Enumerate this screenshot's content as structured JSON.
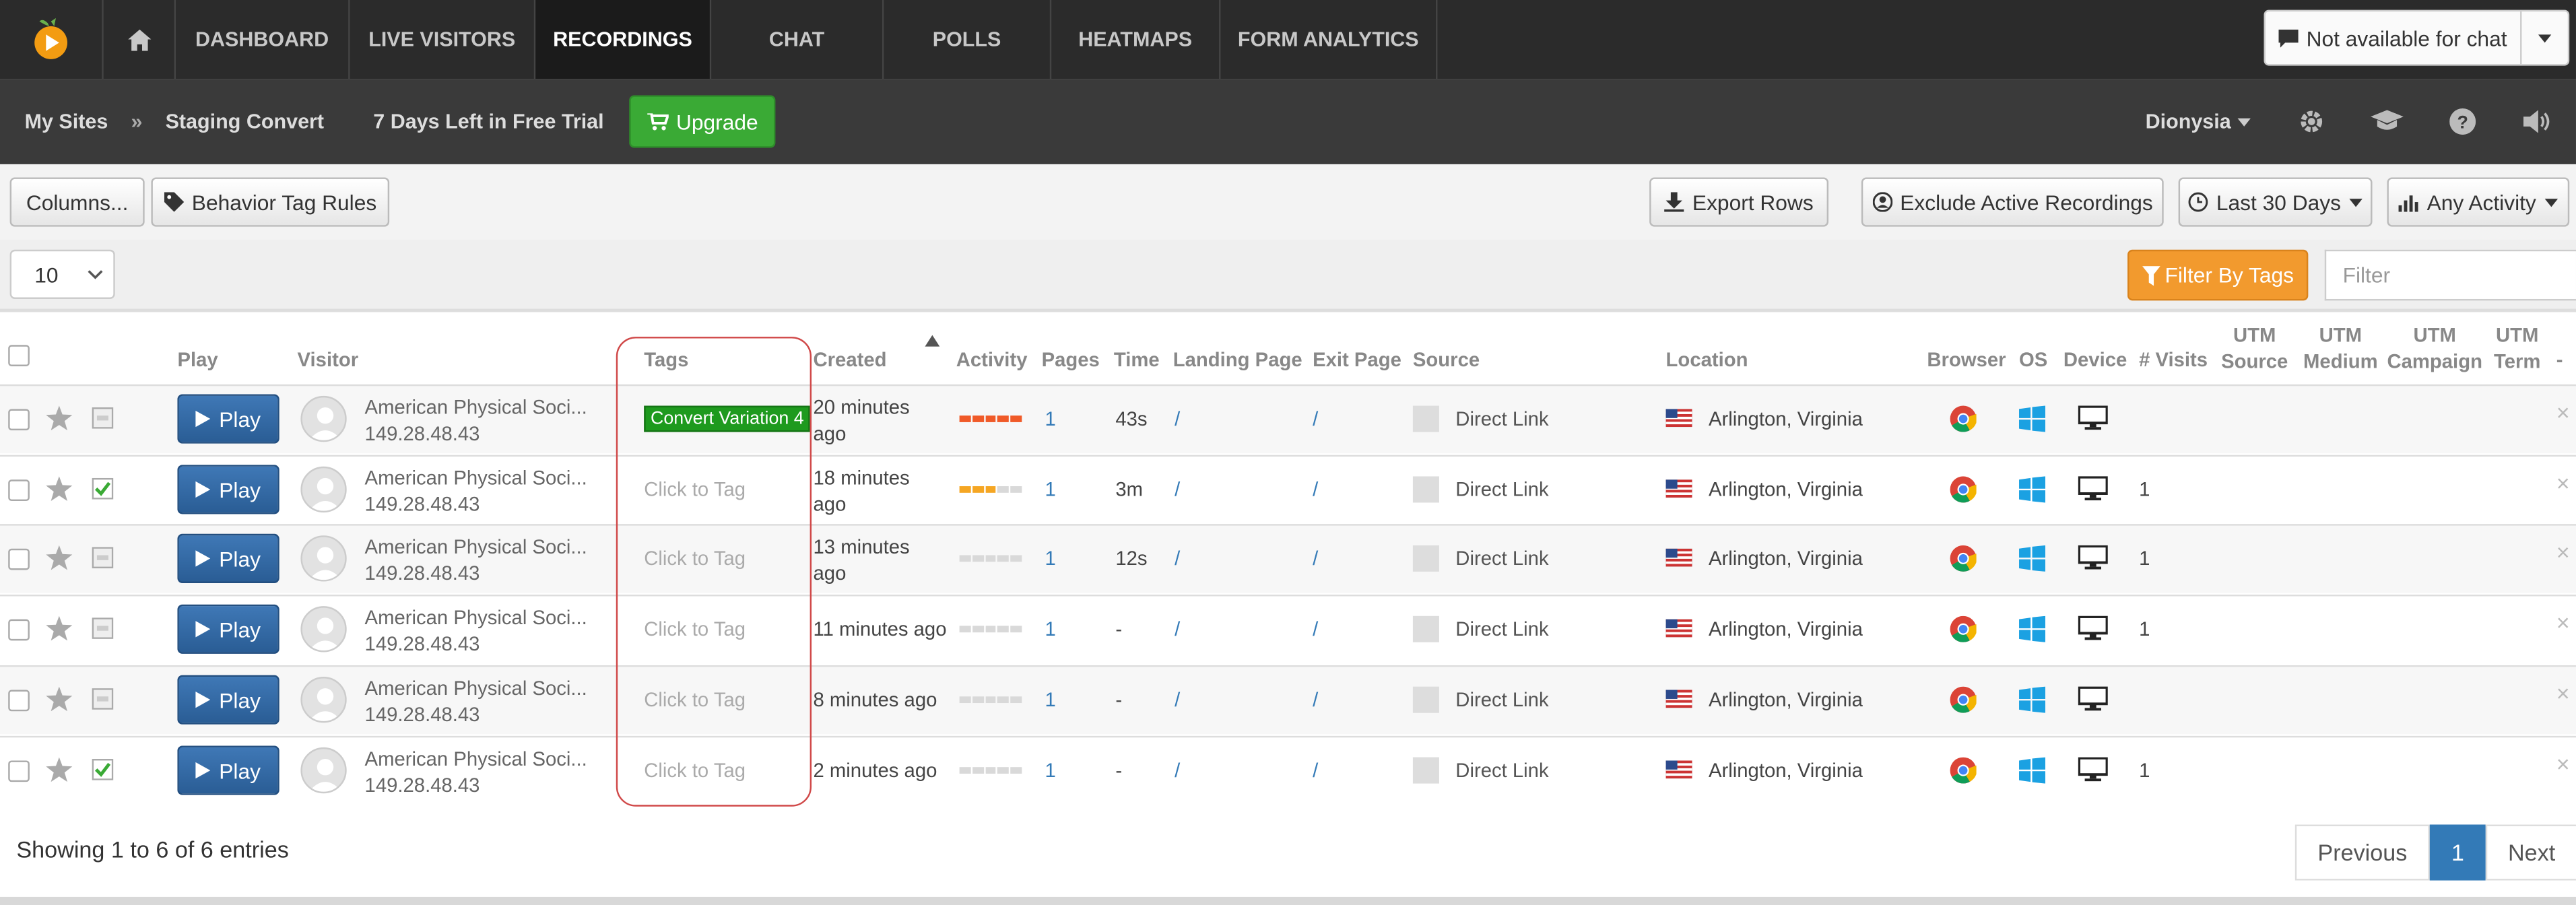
{
  "nav": {
    "items": [
      "DASHBOARD",
      "LIVE VISITORS",
      "RECORDINGS",
      "CHAT",
      "POLLS",
      "HEATMAPS",
      "FORM ANALYTICS"
    ],
    "active": "RECORDINGS",
    "chat_status": "Not available for chat"
  },
  "subbar": {
    "my_sites": "My Sites",
    "separator": "»",
    "site": "Staging Convert",
    "trial": "7 Days Left in Free Trial",
    "upgrade": "Upgrade",
    "user": "Dionysia"
  },
  "toolbar": {
    "columns": "Columns...",
    "behavior_tag_rules": "Behavior Tag Rules",
    "export_rows": "Export Rows",
    "exclude_active": "Exclude Active Recordings",
    "date_range": "Last 30 Days",
    "activity": "Any Activity"
  },
  "filters": {
    "page_size": "10",
    "filter_by_tags": "Filter By Tags",
    "filter_placeholder": "Filter"
  },
  "table": {
    "headers": {
      "play": "Play",
      "visitor": "Visitor",
      "tags": "Tags",
      "created": "Created",
      "activity": "Activity",
      "pages": "Pages",
      "time": "Time",
      "landing_page": "Landing Page",
      "exit_page": "Exit Page",
      "source": "Source",
      "location": "Location",
      "browser": "Browser",
      "os": "OS",
      "device": "Device",
      "visits": "# Visits",
      "utm_source_1": "UTM",
      "utm_source_2": "Source",
      "utm_medium_1": "UTM",
      "utm_medium_2": "Medium",
      "utm_campaign_1": "UTM",
      "utm_campaign_2": "Campaign",
      "utm_term_1": "UTM",
      "utm_term_2": "Term",
      "dash": "-"
    },
    "play_label": "Play",
    "rows": [
      {
        "org": "American Physical Soci...",
        "ip": "149.28.48.43",
        "tag": "Convert Variation 4",
        "created1": "20 minutes",
        "created2": "ago",
        "activity": "high",
        "pages": "1",
        "time": "43s",
        "landing": "/",
        "exit": "/",
        "source": "Direct Link",
        "location": "Arlington, Virginia",
        "visits": "",
        "watched": false
      },
      {
        "org": "American Physical Soci...",
        "ip": "149.28.48.43",
        "tag": "Click to Tag",
        "created1": "18 minutes",
        "created2": "ago",
        "activity": "medium",
        "pages": "1",
        "time": "3m",
        "landing": "/",
        "exit": "/",
        "source": "Direct Link",
        "location": "Arlington, Virginia",
        "visits": "1",
        "watched": true
      },
      {
        "org": "American Physical Soci...",
        "ip": "149.28.48.43",
        "tag": "Click to Tag",
        "created1": "13 minutes",
        "created2": "ago",
        "activity": "low",
        "pages": "1",
        "time": "12s",
        "landing": "/",
        "exit": "/",
        "source": "Direct Link",
        "location": "Arlington, Virginia",
        "visits": "1",
        "watched": false
      },
      {
        "org": "American Physical Soci...",
        "ip": "149.28.48.43",
        "tag": "Click to Tag",
        "created1": "11 minutes ago",
        "created2": "",
        "activity": "low",
        "pages": "1",
        "time": "-",
        "landing": "/",
        "exit": "/",
        "source": "Direct Link",
        "location": "Arlington, Virginia",
        "visits": "1",
        "watched": false
      },
      {
        "org": "American Physical Soci...",
        "ip": "149.28.48.43",
        "tag": "Click to Tag",
        "created1": "8 minutes ago",
        "created2": "",
        "activity": "low",
        "pages": "1",
        "time": "-",
        "landing": "/",
        "exit": "/",
        "source": "Direct Link",
        "location": "Arlington, Virginia",
        "visits": "",
        "watched": false
      },
      {
        "org": "American Physical Soci...",
        "ip": "149.28.48.43",
        "tag": "Click to Tag",
        "created1": "2 minutes ago",
        "created2": "",
        "activity": "low",
        "pages": "1",
        "time": "-",
        "landing": "/",
        "exit": "/",
        "source": "Direct Link",
        "location": "Arlington, Virginia",
        "visits": "1",
        "watched": true
      }
    ],
    "close": "×"
  },
  "footer": {
    "showing": "Showing 1 to 6 of 6 entries",
    "previous": "Previous",
    "page": "1",
    "next": "Next"
  },
  "colors": {
    "activity_high": "#f05a28",
    "activity_medium": "#f5a623",
    "activity_empty": "#d9d9d9",
    "tag_green": "#1e9a1e",
    "upgrade_green": "#3aaa35",
    "filter_orange": "#f29a2e",
    "play_blue": "#2a5d95"
  }
}
